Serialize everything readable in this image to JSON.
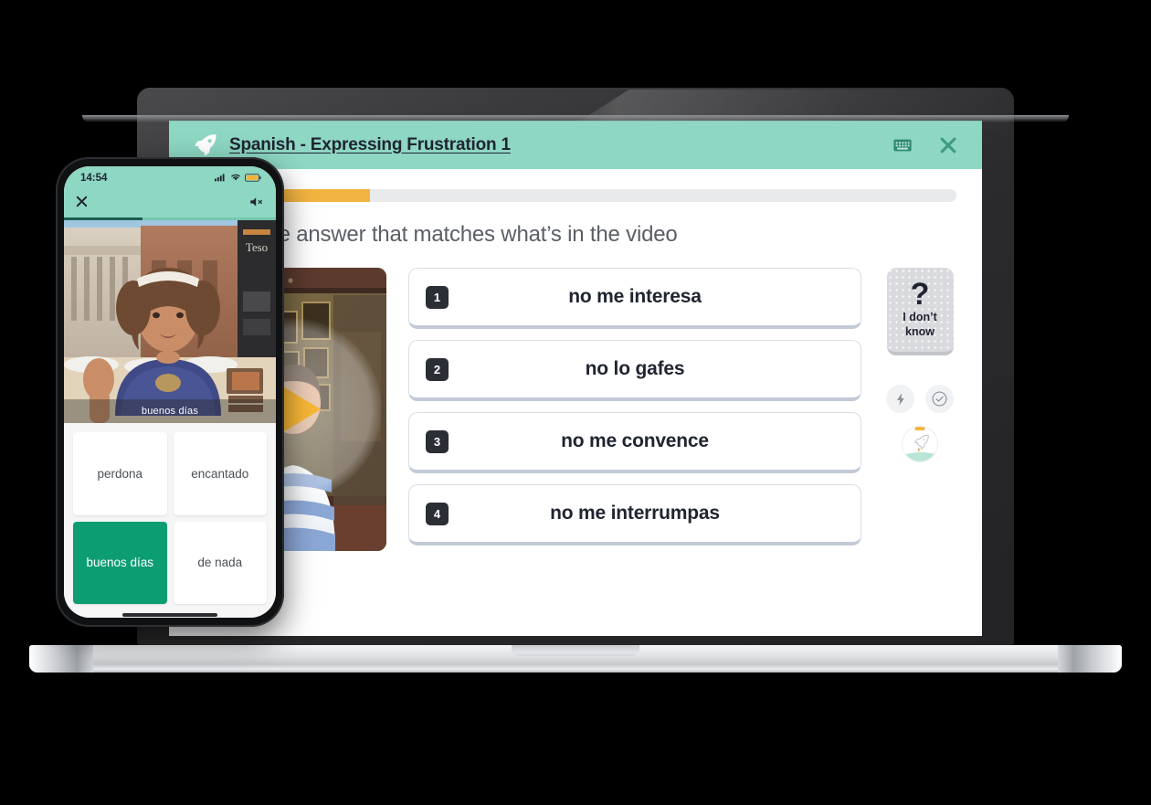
{
  "colors": {
    "mint": "#8DD7C3",
    "amber": "#F2B441",
    "play_yellow": "#F8B836",
    "selected_green": "#0D9D72",
    "dark_text": "#1F2430",
    "card_border": "#D9DEE6",
    "progress_track": "#E8EAEC"
  },
  "desktop": {
    "header": {
      "logo_icon": "rocket-icon",
      "title": "Spanish - Expressing Frustration 1",
      "keyboard_icon": "keyboard-icon",
      "close_icon": "close-icon"
    },
    "progress": {
      "percent": 23
    },
    "prompt": "Select the answer that matches what’s in the video",
    "video": {
      "play_icon": "play-icon"
    },
    "options": [
      {
        "number": "1",
        "label": "no me interesa"
      },
      {
        "number": "2",
        "label": "no lo gafes"
      },
      {
        "number": "3",
        "label": "no me convence"
      },
      {
        "number": "4",
        "label": "no me interrumpas"
      }
    ],
    "dont_know": {
      "glyph": "?",
      "line1": "I don’t",
      "line2": "know"
    },
    "side_icons": [
      {
        "name": "lightning-icon"
      },
      {
        "name": "check-circle-icon"
      }
    ],
    "rocket_badge": {
      "name": "rocket-progress-badge"
    }
  },
  "phone": {
    "status": {
      "time": "14:54",
      "signal_icon": "cellular-signal-icon",
      "wifi_icon": "wifi-icon",
      "battery_icon": "battery-low-power-icon"
    },
    "header": {
      "close_icon": "close-icon",
      "mute_icon": "volume-muted-icon"
    },
    "progress": {
      "percent": 37
    },
    "video": {
      "subtitle": "buenos días"
    },
    "tiles": [
      {
        "label": "perdona",
        "selected": false
      },
      {
        "label": "encantado",
        "selected": false
      },
      {
        "label": "buenos días",
        "selected": true
      },
      {
        "label": "de nada",
        "selected": false
      }
    ]
  }
}
